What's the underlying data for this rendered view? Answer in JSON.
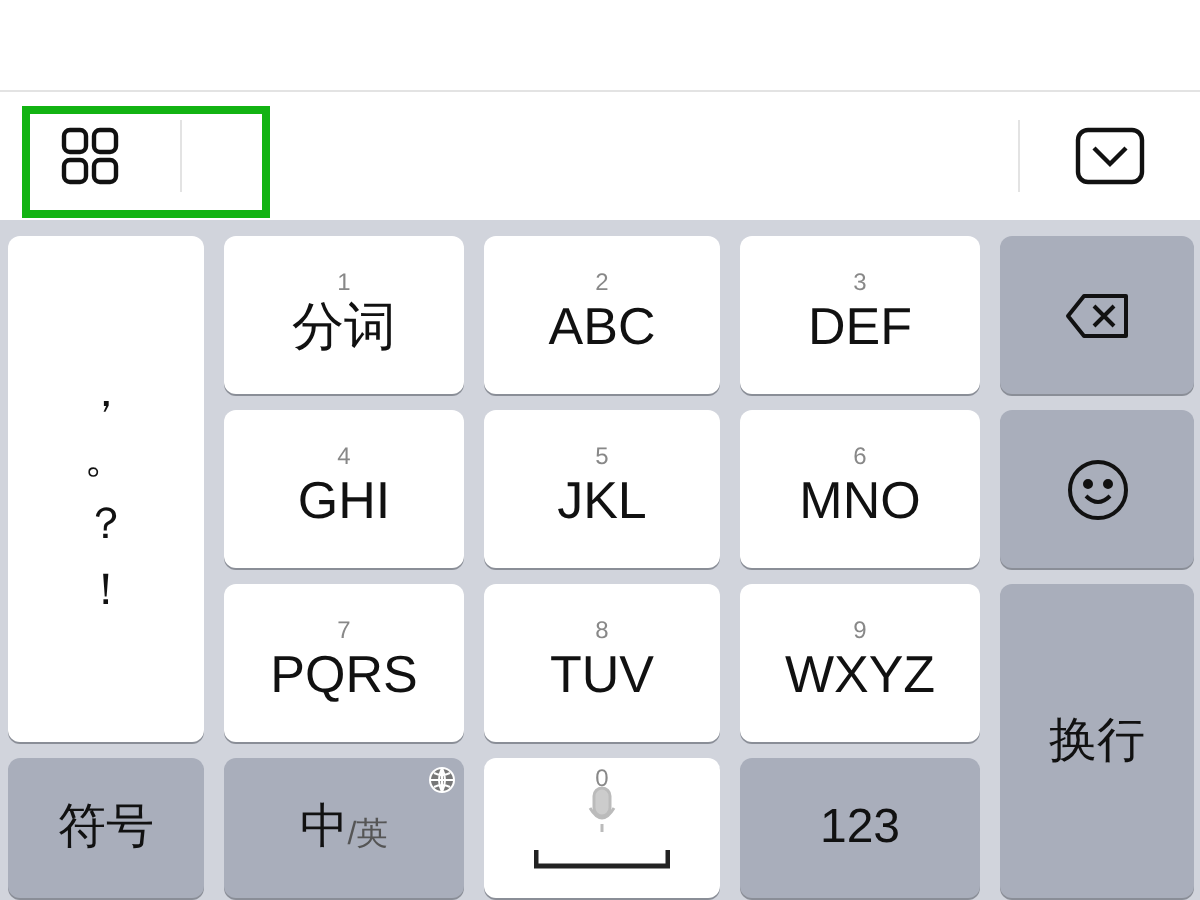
{
  "toolbar": {
    "highlighted": true
  },
  "keys": [
    {
      "kind": "punct",
      "items": [
        "，",
        "。",
        "？",
        "！"
      ]
    },
    {
      "kind": "letters",
      "number": "1",
      "label": "分词"
    },
    {
      "kind": "letters",
      "number": "2",
      "label": "ABC"
    },
    {
      "kind": "letters",
      "number": "3",
      "label": "DEF"
    },
    {
      "kind": "backspace"
    },
    {
      "kind": "letters",
      "number": "4",
      "label": "GHI"
    },
    {
      "kind": "letters",
      "number": "5",
      "label": "JKL"
    },
    {
      "kind": "letters",
      "number": "6",
      "label": "MNO"
    },
    {
      "kind": "emoji"
    },
    {
      "kind": "letters",
      "number": "7",
      "label": "PQRS"
    },
    {
      "kind": "letters",
      "number": "8",
      "label": "TUV"
    },
    {
      "kind": "letters",
      "number": "9",
      "label": "WXYZ"
    },
    {
      "kind": "enter",
      "label": "换行"
    },
    {
      "kind": "symbols",
      "label": "符号"
    },
    {
      "kind": "lang",
      "label": "中",
      "secondary": "/英"
    },
    {
      "kind": "space",
      "number": "0"
    },
    {
      "kind": "numbers",
      "label": "123"
    }
  ]
}
